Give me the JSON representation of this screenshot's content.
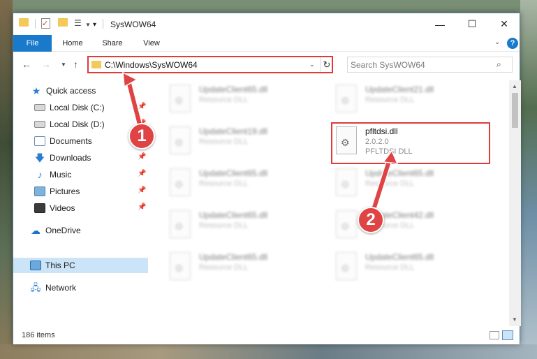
{
  "window": {
    "title": "SysWOW64"
  },
  "ribbon": {
    "tabs": [
      "File",
      "Home",
      "Share",
      "View"
    ]
  },
  "navbar": {
    "address": "C:\\Windows\\SysWOW64",
    "search_placeholder": "Search SysWOW64"
  },
  "sidebar": {
    "items": [
      {
        "label": "Quick access",
        "icon": "star-icon",
        "pinned": false
      },
      {
        "label": "Local Disk (C:)",
        "icon": "drive-icon",
        "pinned": true
      },
      {
        "label": "Local Disk (D:)",
        "icon": "drive-icon",
        "pinned": true
      },
      {
        "label": "Documents",
        "icon": "documents-icon",
        "pinned": true
      },
      {
        "label": "Downloads",
        "icon": "downloads-icon",
        "pinned": true
      },
      {
        "label": "Music",
        "icon": "music-icon",
        "pinned": true
      },
      {
        "label": "Pictures",
        "icon": "pictures-icon",
        "pinned": true
      },
      {
        "label": "Videos",
        "icon": "videos-icon",
        "pinned": true
      },
      {
        "label": "OneDrive",
        "icon": "onedrive-icon",
        "pinned": false
      },
      {
        "label": "This PC",
        "icon": "this-pc-icon",
        "pinned": false,
        "selected": true
      },
      {
        "label": "Network",
        "icon": "network-icon",
        "pinned": false
      }
    ]
  },
  "files": {
    "left_column": [
      {
        "name": "UpdateClient65.dll",
        "type": "Resource DLL"
      },
      {
        "name": "UpdateClient19.dll",
        "type": "Resource DLL"
      },
      {
        "name": "UpdateClient65.dll",
        "type": "Resource DLL"
      },
      {
        "name": "UpdateClient65.dll",
        "type": "Resource DLL"
      },
      {
        "name": "UpdateClient65.dll",
        "type": "Resource DLL"
      }
    ],
    "right_column": [
      {
        "name": "UpdateClient21.dll",
        "type": "Resource DLL"
      },
      {
        "name": "pfltdsi.dll",
        "version": "2.0.2.0",
        "type": "PFLTDSI DLL",
        "highlighted": true
      },
      {
        "name": "UpdateClient65.dll",
        "type": "Resource DLL"
      },
      {
        "name": "UpdateClient42.dll",
        "type": "Resource DLL"
      },
      {
        "name": "UpdateClient65.dll",
        "type": "Resource DLL"
      }
    ]
  },
  "status": {
    "item_count": "186 items"
  },
  "callouts": [
    "1",
    "2"
  ],
  "colors": {
    "accent": "#1979ca",
    "highlight": "#e03a3a",
    "selected_bg": "#cce4f7"
  }
}
